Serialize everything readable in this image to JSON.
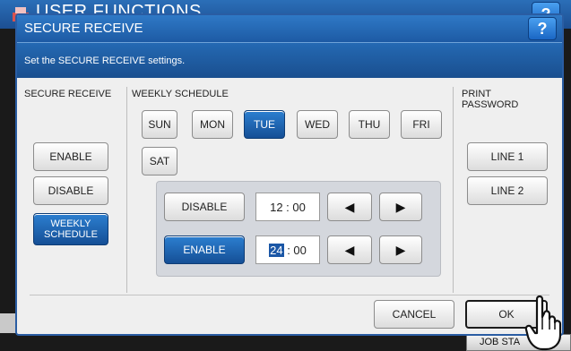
{
  "background": {
    "title": "USER FUNCTIONS",
    "help_label": "?",
    "job_status_label": "JOB STA"
  },
  "dialog": {
    "title": "SECURE RECEIVE",
    "help_label": "?",
    "message": "Set the SECURE RECEIVE settings."
  },
  "secure_receive": {
    "label": "SECURE RECEIVE",
    "options": [
      "ENABLE",
      "DISABLE",
      "WEEKLY SCHEDULE"
    ],
    "selected": "WEEKLY SCHEDULE"
  },
  "weekly_schedule": {
    "label": "WEEKLY SCHEDULE",
    "days": [
      "SUN",
      "MON",
      "TUE",
      "WED",
      "THU",
      "FRI",
      "SAT"
    ],
    "selected_day": "TUE",
    "rows": [
      {
        "mode_label": "DISABLE",
        "time": "12 : 00",
        "selected": false
      },
      {
        "mode_label": "ENABLE",
        "time_hour": "24",
        "time_rest": " : 00",
        "selected": true
      }
    ],
    "arrow_left": "◀",
    "arrow_right": "▶"
  },
  "print_password": {
    "label": "PRINT PASSWORD",
    "lines": [
      "LINE 1",
      "LINE 2"
    ]
  },
  "footer": {
    "cancel_label": "CANCEL",
    "ok_label": "OK"
  },
  "colors": {
    "accent_blue": "#1d5aa4",
    "selected_button": "#154f96",
    "dialog_bg": "#efefef"
  }
}
